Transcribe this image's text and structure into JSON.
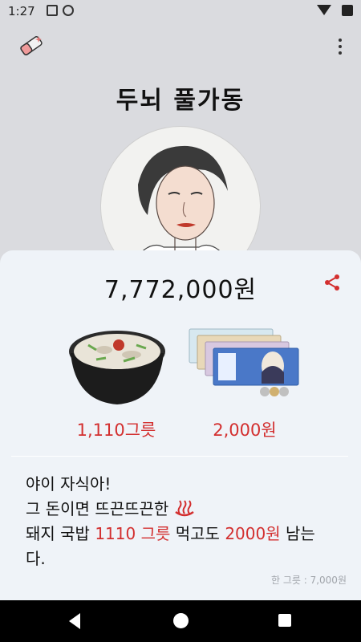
{
  "status": {
    "time": "1:27"
  },
  "app": {
    "title": "두뇌 풀가동"
  },
  "result": {
    "amount": "7,772,000원",
    "bowl_count": "1,110그릇",
    "remaining": "2,000원"
  },
  "message": {
    "line1": "야이 자식아!",
    "line2": "그 돈이면 뜨끈뜨끈한",
    "line3_a": "돼지 국밥",
    "line3_count": "1110 그릇",
    "line3_b": "먹고도",
    "line3_rest": "2000원",
    "line3_c": "남는",
    "line4": "다.",
    "footnote": "한 그릇 : 7,000원"
  },
  "colors": {
    "accent": "#d32f2f",
    "sheet_bg": "#eff3f8",
    "page_bg": "#dadbdf"
  },
  "icons": [
    "eraser-icon",
    "more-vert-icon",
    "share-icon",
    "hotspring-icon",
    "back-icon",
    "home-icon",
    "recents-icon"
  ]
}
